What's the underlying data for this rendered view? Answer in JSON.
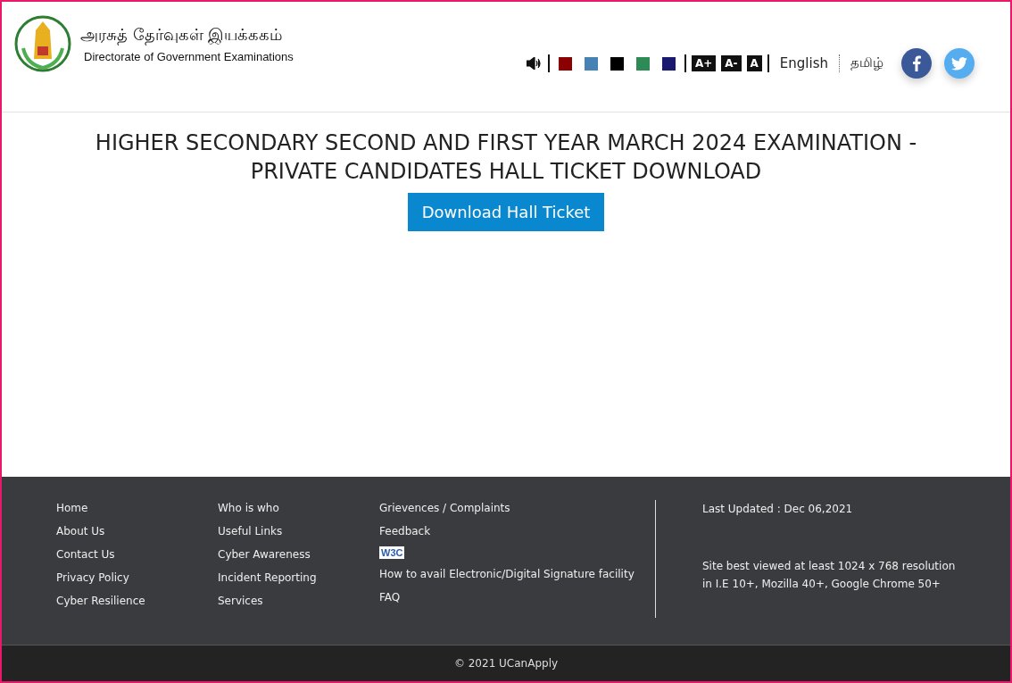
{
  "header": {
    "title_tamil": "அரசுத் தேர்வுகள் இயக்ககம்",
    "title_english": "Directorate of Government Examinations",
    "theme_colors": [
      {
        "color": "#8b0000"
      },
      {
        "color": "#4682b4"
      },
      {
        "color": "#000000"
      },
      {
        "color": "#2e8b57"
      },
      {
        "color": "#191970"
      }
    ],
    "font_sizes": [
      "A+",
      "A-",
      "A"
    ],
    "languages": [
      "English",
      "தமிழ்"
    ]
  },
  "main": {
    "heading": "HIGHER SECONDARY SECOND AND FIRST YEAR MARCH 2024 EXAMINATION - PRIVATE CANDIDATES HALL TICKET DOWNLOAD",
    "button": "Download Hall Ticket"
  },
  "footer": {
    "columns": [
      [
        "Home",
        "About Us",
        "Contact Us",
        "Privacy Policy",
        "Cyber Resilience"
      ],
      [
        "Who is who",
        "Useful Links",
        "Cyber Awareness",
        "Incident Reporting",
        "Services"
      ],
      [
        {
          "kind": "link",
          "text": "Grievences / Complaints"
        },
        {
          "kind": "link",
          "text": "Feedback"
        },
        {
          "kind": "badge",
          "text": "W3C"
        },
        {
          "kind": "link",
          "text": "How to avail Electronic/Digital Signature facility"
        },
        {
          "kind": "link",
          "text": "FAQ"
        }
      ]
    ],
    "last_updated": "Last Updated : Dec 06,2021",
    "best_viewed": "Site best viewed at least 1024 x 768 resolution in I.E 10+, Mozilla 40+, Google Chrome 50+"
  },
  "copyright": "© 2021 UCanApply"
}
